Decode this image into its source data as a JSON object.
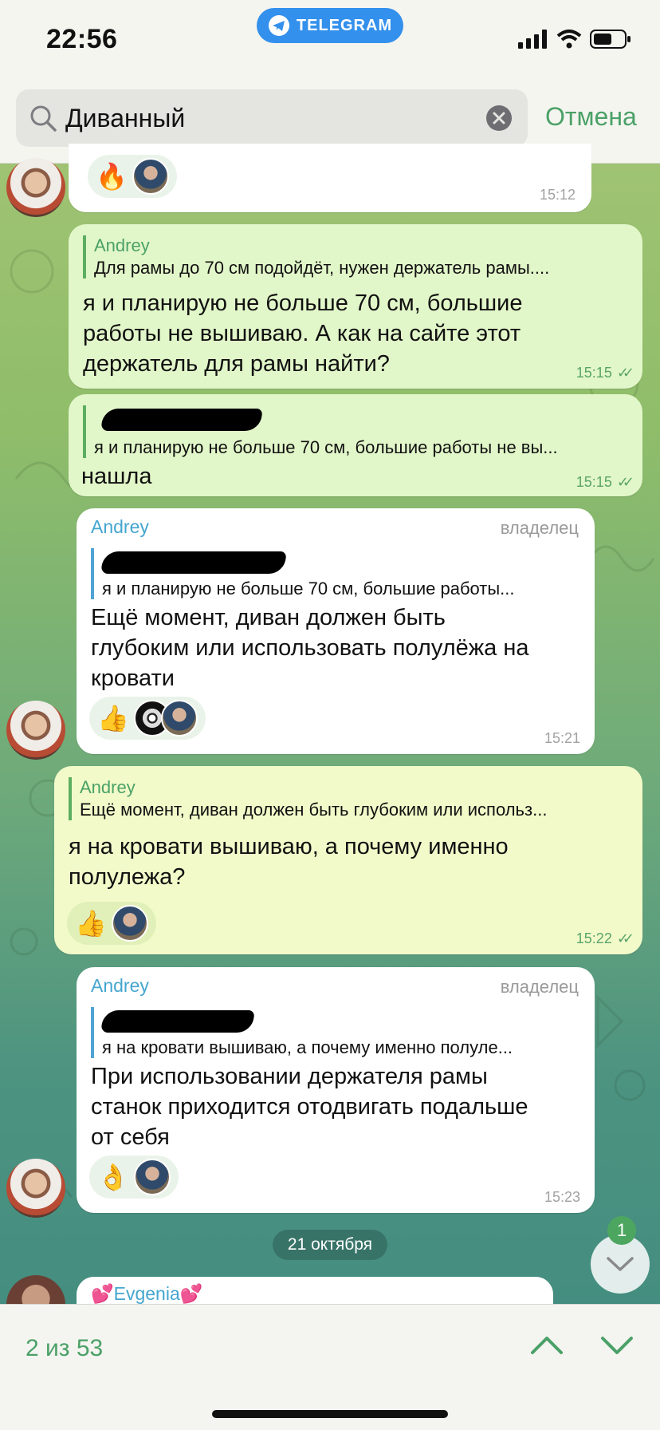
{
  "status_bar": {
    "time": "22:56",
    "app_pill": "TELEGRAM"
  },
  "search": {
    "query": "Диванный",
    "cancel_label": "Отмена"
  },
  "messages": [
    {
      "id": "m0",
      "direction": "in",
      "time": "15:12"
    },
    {
      "id": "m1",
      "direction": "out",
      "reply_name": "Andrey",
      "reply_text": "Для рамы до 70 см подойдёт, нужен держатель рамы....",
      "text_lines": [
        "я и планирую не больше 70 см, большие",
        "работы не вышиваю. А как на сайте этот",
        "держатель для рамы найти?"
      ],
      "time": "15:15"
    },
    {
      "id": "m2",
      "direction": "out",
      "reply_text": "я и планирую не больше 70 см, большие работы не вы...",
      "text_lines": [
        "нашла"
      ],
      "time": "15:15"
    },
    {
      "id": "m3",
      "direction": "in",
      "sender": "Andrey",
      "owner_tag": "владелец",
      "reply_text": "я и планирую не больше 70 см, большие работы...",
      "text_lines": [
        "Ещё момент, диван должен быть",
        "глубоким или использовать полулёжа на",
        "кровати"
      ],
      "reaction": "👍",
      "time": "15:21"
    },
    {
      "id": "m4",
      "direction": "out",
      "reply_name": "Andrey",
      "reply_text": "Ещё момент, диван должен быть глубоким или использ...",
      "text_lines": [
        "я на кровати вышиваю, а почему именно",
        "полулежа?"
      ],
      "reaction": "👍",
      "time": "15:22"
    },
    {
      "id": "m5",
      "direction": "in",
      "sender": "Andrey",
      "owner_tag": "владелец",
      "reply_text": "я на кровати вышиваю, а почему именно полуле...",
      "text_lines": [
        "При использовании держателя рамы",
        "станок приходится отодвигать подальше",
        "от себя"
      ],
      "reaction": "👌",
      "time": "15:23"
    }
  ],
  "date_separator": "21 октября",
  "next_sender": "💕Evgenia💕",
  "unread_count": "1",
  "m0_reaction": "🔥",
  "bottom": {
    "result_count": "2 из 53"
  },
  "colors": {
    "accent_green": "#4ba167",
    "sender_blue": "#45a6cf",
    "out_bubble": "#e2f7c9",
    "highlighted_bubble": "#f2fac9"
  }
}
